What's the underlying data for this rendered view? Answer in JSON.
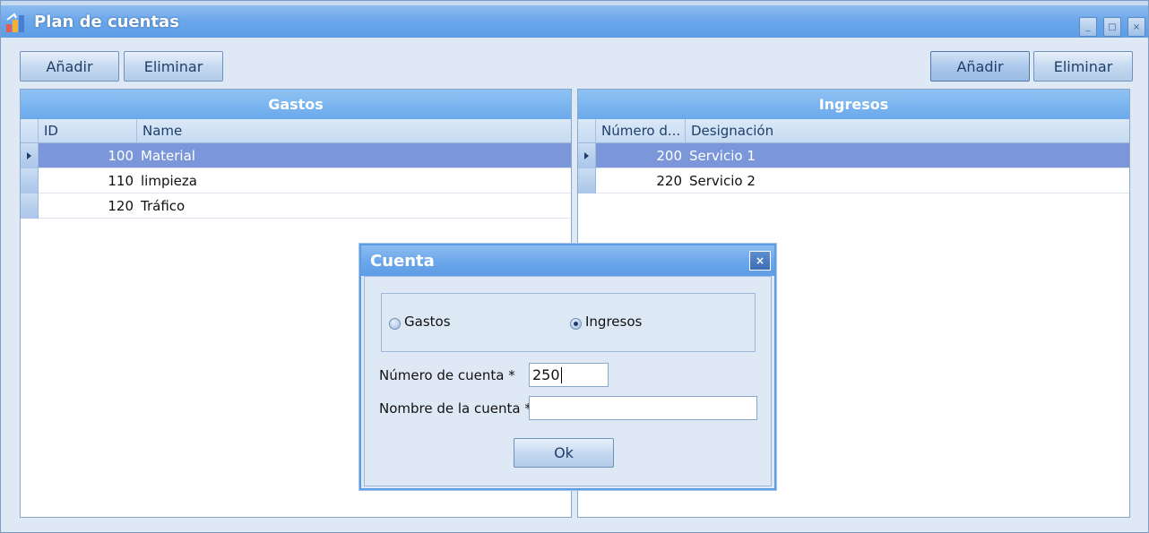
{
  "window": {
    "title": "Plan de cuentas",
    "controls": [
      "_",
      "□",
      "×"
    ]
  },
  "left": {
    "add_label": "Añadir",
    "delete_label": "Eliminar",
    "grid": {
      "title": "Gastos",
      "columns": [
        "ID",
        "Name"
      ],
      "rows": [
        {
          "id": "100",
          "name": "Material"
        },
        {
          "id": "110",
          "name": "limpieza"
        },
        {
          "id": "120",
          "name": "Tráfico"
        }
      ]
    }
  },
  "right": {
    "add_label": "Añadir",
    "delete_label": "Eliminar",
    "grid": {
      "title": "Ingresos",
      "columns": [
        "Número d...",
        "Designación"
      ],
      "rows": [
        {
          "id": "200",
          "name": "Servicio 1"
        },
        {
          "id": "220",
          "name": "Servicio 2"
        }
      ]
    }
  },
  "dialog": {
    "title": "Cuenta",
    "close": "×",
    "radio_gastos": "Gastos",
    "radio_ingresos": "Ingresos",
    "selected": "Ingresos",
    "account_number_label": "Número de cuenta *",
    "account_number_value": "250",
    "account_name_label": "Nombre de la cuenta *",
    "account_name_value": "",
    "ok_label": "Ok"
  },
  "colors": {
    "accent": "#6aa6ea",
    "selection": "#7b97d9",
    "background": "#dfe9f6"
  },
  "icons": [
    "app-icon",
    "minimize-icon",
    "maximize-icon",
    "close-icon",
    "row-indicator-arrow-icon"
  ]
}
